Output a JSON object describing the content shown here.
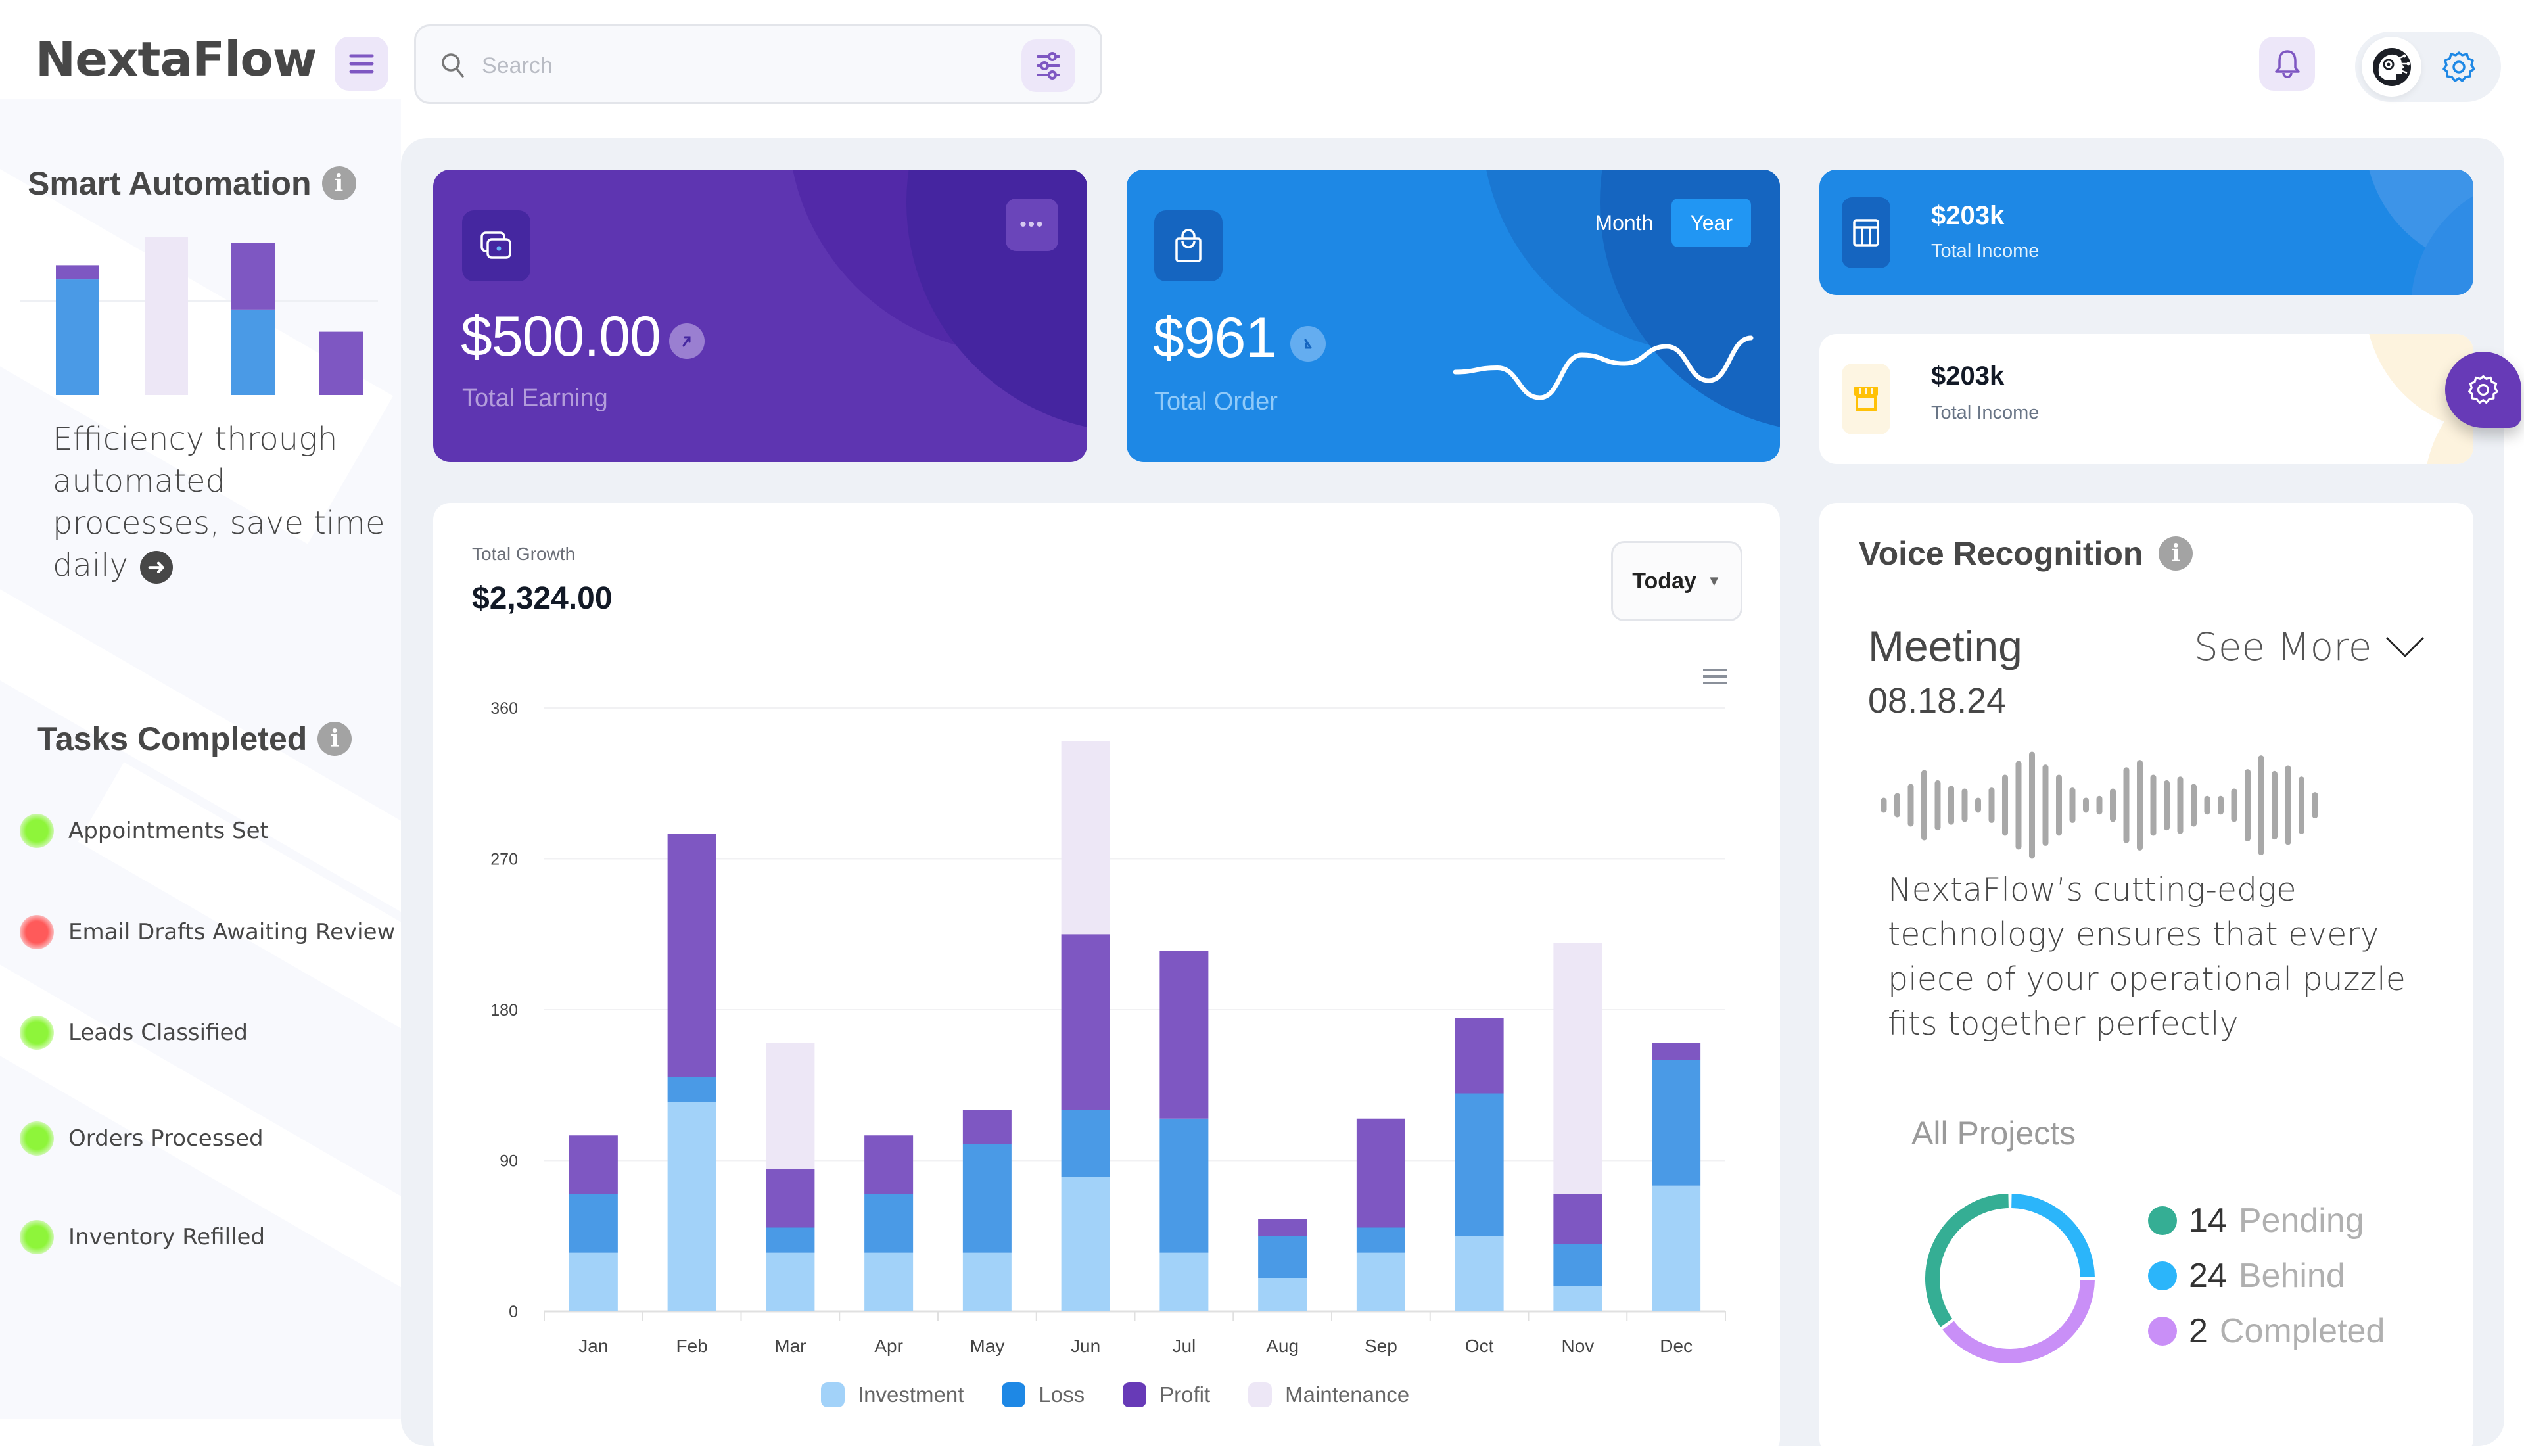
{
  "app": {
    "name": "NextaFlow"
  },
  "header": {
    "search_placeholder": "Search",
    "icons": [
      "menu-icon",
      "search-icon",
      "filter-icon",
      "bell-icon",
      "ai-avatar-icon",
      "settings-icon"
    ]
  },
  "sidebar": {
    "smart_automation": {
      "title": "Smart Automation",
      "description": "Efficiency through automated processes, save time daily",
      "mini_chart": {
        "bars": [
          {
            "loss": 73,
            "profit": 9,
            "maintenance": 0
          },
          {
            "loss": 0,
            "profit": 0,
            "maintenance": 100
          },
          {
            "loss": 54,
            "profit": 42,
            "maintenance": 0
          },
          {
            "loss": 0,
            "profit": 40,
            "maintenance": 0
          }
        ]
      }
    },
    "tasks_completed": {
      "title": "Tasks Completed",
      "items": [
        {
          "label": "Appointments Set",
          "status": "done",
          "color": "#8ef53a"
        },
        {
          "label": "Email Drafts Awaiting Review",
          "status": "pending",
          "color": "#ff5a5a"
        },
        {
          "label": "Leads Classified",
          "status": "done",
          "color": "#8ef53a"
        },
        {
          "label": "Orders Processed",
          "status": "done",
          "color": "#8ef53a"
        },
        {
          "label": "Inventory Refilled",
          "status": "done",
          "color": "#8ef53a"
        }
      ]
    }
  },
  "cards": {
    "earning": {
      "value": "$500.00",
      "label": "Total Earning",
      "trend": "up"
    },
    "order": {
      "value": "$961",
      "label": "Total Order",
      "trend": "down",
      "toggle": [
        "Month",
        "Year"
      ],
      "toggle_active": "Year",
      "sparkline": [
        40,
        45,
        10,
        60,
        50,
        70,
        30,
        80
      ]
    },
    "income_blue": {
      "value": "$203k",
      "label": "Total Income"
    },
    "income_white": {
      "value": "$203k",
      "label": "Total Income"
    }
  },
  "growth": {
    "label": "Total Growth",
    "value": "$2,324.00",
    "period": "Today"
  },
  "chart_data": {
    "type": "bar",
    "stacked": true,
    "title": "Total Growth",
    "categories": [
      "Jan",
      "Feb",
      "Mar",
      "Apr",
      "May",
      "Jun",
      "Jul",
      "Aug",
      "Sep",
      "Oct",
      "Nov",
      "Dec"
    ],
    "series": [
      {
        "name": "Investment",
        "color": "#a2d2f9",
        "values": [
          35,
          125,
          35,
          35,
          35,
          80,
          35,
          20,
          35,
          45,
          15,
          75
        ]
      },
      {
        "name": "Loss",
        "color": "#4a9ae6",
        "values": [
          35,
          15,
          15,
          35,
          65,
          40,
          80,
          25,
          15,
          85,
          25,
          75
        ]
      },
      {
        "name": "Profit",
        "color": "#7e57c2",
        "values": [
          35,
          145,
          35,
          35,
          20,
          105,
          100,
          10,
          65,
          45,
          30,
          10
        ]
      },
      {
        "name": "Maintenance",
        "color": "#ede7f6",
        "values": [
          0,
          0,
          75,
          0,
          0,
          115,
          0,
          0,
          0,
          0,
          150,
          0
        ]
      }
    ],
    "yticks": [
      0,
      90,
      180,
      270,
      360
    ],
    "ylim": [
      0,
      360
    ],
    "xlabel": "",
    "ylabel": "",
    "grid": true,
    "legend": "bottom-center"
  },
  "voice": {
    "title": "Voice Recognition",
    "meeting_title": "Meeting",
    "meeting_date": "08.18.24",
    "see_more": "See More",
    "waveform": [
      10,
      20,
      40,
      70,
      48,
      36,
      30,
      10,
      32,
      60,
      90,
      110,
      82,
      60,
      32,
      10,
      14,
      30,
      76,
      92,
      60,
      48,
      56,
      40,
      14,
      14,
      30,
      72,
      102,
      68,
      80,
      56,
      22
    ],
    "description": "NextaFlow’s cutting-edge technology ensures that every piece of your operational puzzle fits together perfectly",
    "projects": {
      "title": "All Projects",
      "items": [
        {
          "count": "14",
          "label": "Pending",
          "color": "#35ae94"
        },
        {
          "count": "24",
          "label": "Behind",
          "color": "#2bb5fa"
        },
        {
          "count": "2",
          "label": "Completed",
          "color": "#c98ff7"
        }
      ],
      "ring_fractions": {
        "Pending": 0.35,
        "Behind": 0.25,
        "Completed": 0.4
      }
    }
  }
}
